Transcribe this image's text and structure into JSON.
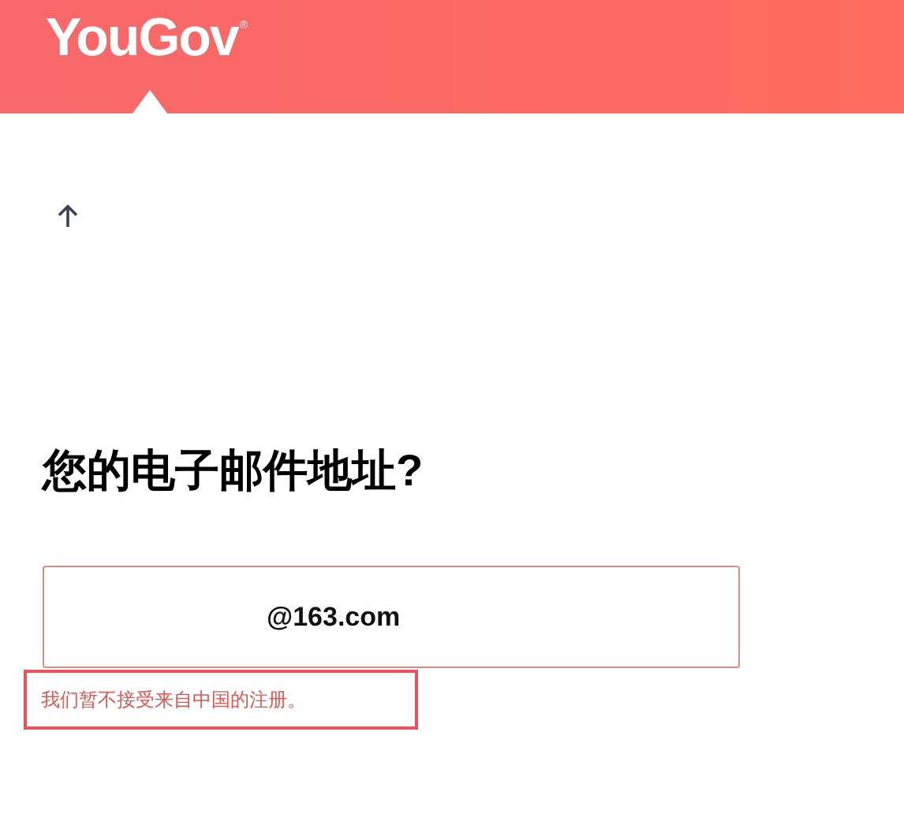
{
  "header": {
    "logo": "YouGov",
    "logo_mark": "®"
  },
  "question": "您的电子邮件地址?",
  "email_field": {
    "value": "@163.com",
    "invalid": true
  },
  "error_message": "我们暂不接受来自中国的注册。"
}
